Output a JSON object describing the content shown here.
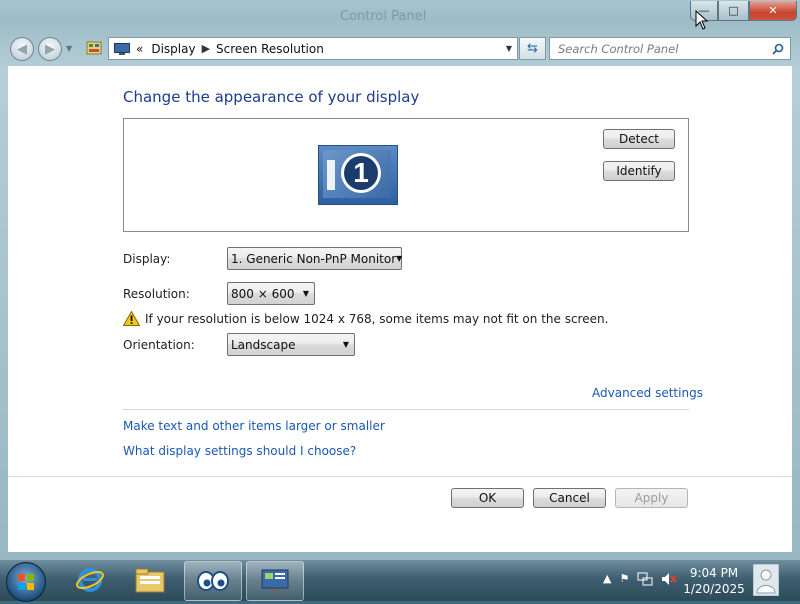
{
  "window": {
    "title": "Control Panel",
    "caption_buttons": {
      "minimize": "—",
      "maximize": "□",
      "close": "✕"
    }
  },
  "nav": {
    "breadcrumb": [
      "Display",
      "Screen Resolution"
    ],
    "overflow": "«",
    "search_placeholder": "Search Control Panel"
  },
  "main": {
    "heading": "Change the appearance of your display",
    "monitor_number": "1",
    "detect_label": "Detect",
    "identify_label": "Identify",
    "display_label": "Display:",
    "display_value": "1. Generic Non-PnP Monitor",
    "resolution_label": "Resolution:",
    "resolution_value": "800 × 600",
    "warning": "If your resolution is below 1024 x 768, some items may not fit on the screen.",
    "orientation_label": "Orientation:",
    "orientation_value": "Landscape",
    "advanced_link": "Advanced settings",
    "link_text_size": "Make text and other items larger or smaller",
    "link_help": "What display settings should I choose?",
    "ok_label": "OK",
    "cancel_label": "Cancel",
    "apply_label": "Apply"
  },
  "taskbar": {
    "items": [
      "start-orb",
      "internet-explorer-icon",
      "windows-explorer-icon",
      "eyes-app-icon",
      "control-panel-display-icon"
    ],
    "time": "9:04 PM",
    "date": "1/20/2025"
  },
  "colors": {
    "accent_link": "#1a57b3",
    "heading": "#1f3b8f",
    "taskbar": "#3f5f70",
    "close_button": "#c74430"
  }
}
